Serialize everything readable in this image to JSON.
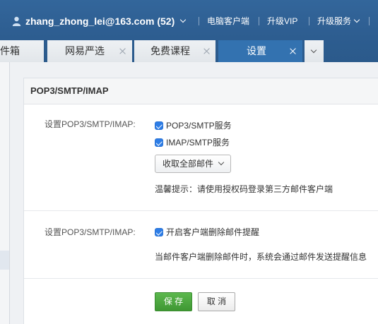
{
  "header": {
    "account": "zhang_zhong_lei@163.com (52)",
    "account_icon": "user-icon",
    "links": [
      {
        "label": "电脑客户端"
      },
      {
        "label": "升级VIP"
      },
      {
        "label": "升级服务",
        "icon": "chevron-down-icon"
      }
    ]
  },
  "tabs": [
    {
      "label": "件箱",
      "closable": false,
      "active": false
    },
    {
      "label": "网易严选",
      "closable": true,
      "active": false
    },
    {
      "label": "免费课程",
      "closable": true,
      "active": false
    },
    {
      "label": "设置",
      "closable": true,
      "active": true
    }
  ],
  "tabs_menu_icon": "chevron-down-icon",
  "settings": {
    "panel_title": "POP3/SMTP/IMAP",
    "section1": {
      "label": "设置POP3/SMTP/IMAP:",
      "options": [
        {
          "label": "POP3/SMTP服务",
          "checked": true
        },
        {
          "label": "IMAP/SMTP服务",
          "checked": true
        }
      ],
      "fetch_select": {
        "value": "收取全部邮件",
        "icon": "chevron-down-icon"
      },
      "tip": "温馨提示：请使用授权码登录第三方邮件客户端"
    },
    "section2": {
      "label": "设置POP3/SMTP/IMAP:",
      "option": {
        "label": "开启客户端删除邮件提醒",
        "checked": true
      },
      "description": "当邮件客户端删除邮件时，系统会通过邮件发送提醒信息"
    },
    "actions": {
      "save_label": "保 存",
      "cancel_label": "取 消"
    }
  },
  "colors": {
    "header_bg": "#2d5d90",
    "active_tab": "#3372b0",
    "checkbox": "#2d7de6",
    "save_button": "#48a23c"
  }
}
